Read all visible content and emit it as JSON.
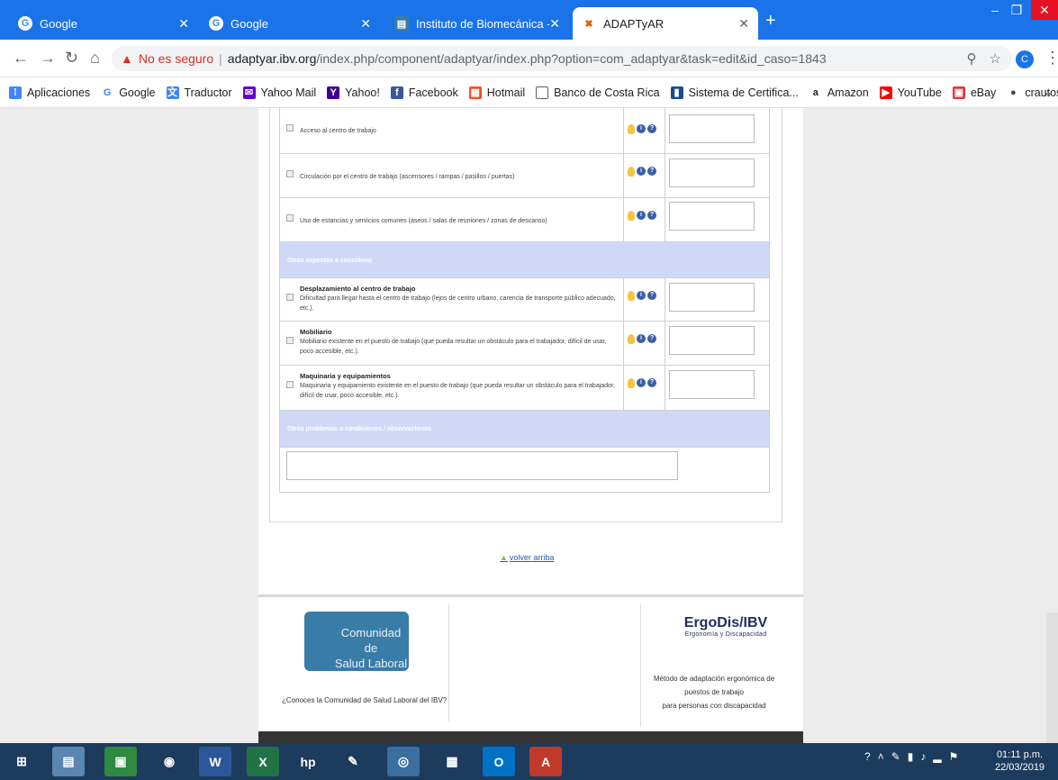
{
  "tabs": [
    {
      "title": "Google",
      "icon": "google-icon"
    },
    {
      "title": "Google",
      "icon": "google-icon"
    },
    {
      "title": "Instituto de Biomecánica - ¿Qué",
      "icon": "ibv-icon"
    },
    {
      "title": "ADAPTyAR",
      "icon": "adaptyar-icon"
    }
  ],
  "address": {
    "security": "No es seguro",
    "host": "adaptyar.ibv.org",
    "path": "/index.php/component/adaptyar/index.php?option=com_adaptyar&task=edit&id_caso=1843"
  },
  "profile_initial": "C",
  "bookmarks": [
    "Aplicaciones",
    "Google",
    "Traductor",
    "Yahoo Mail",
    "Yahoo!",
    "Facebook",
    "Hotmail",
    "Banco de Costa Rica",
    "Sistema de Certifica...",
    "Amazon",
    "YouTube",
    "eBay",
    "crautos.com"
  ],
  "rows": [
    {
      "title": "",
      "text": "Acceso al centro de trabajo"
    },
    {
      "title": "",
      "text": "Circulación por el centro de trabajo (ascensores / rampas / pasillos / puertas)"
    },
    {
      "title": "",
      "text": "Uso de estancias y servicios comunes (aseos / salas de reuniones / zonas de descanso)"
    },
    {
      "title": "Desplazamiento al centro de trabajo",
      "text": "Dificultad para llegar hasta el centro de trabajo (lejos de centro urbano, carencia de transporte público adecuado, etc.)."
    },
    {
      "title": "Mobiliario",
      "text": "Mobiliario existente en el puesto de trabajo (que pueda resultar un obstáculo para el trabajador, difícil de usar, poco accesible, etc.)."
    },
    {
      "title": "Maquinaria y equipamientos",
      "text": "Maquinaria y equipamiento existente en el puesto de trabajo (que pueda resultar un obstáculo para el trabajador, difícil de usar, poco accesible, etc.)."
    }
  ],
  "sections": {
    "otros_aspectos": "Otros aspectos a considerar",
    "otros_problemas": "Otros problemas o condiciones / observaciones"
  },
  "back_to_top": "volver arriba",
  "footer": {
    "com_logo_line1": "Comunidad de",
    "com_logo_line2": "Salud Laboral",
    "com_question": "¿Conoces la Comunidad de Salud Laboral del IBV?",
    "ergo_brand": "ErgoDis/IBV",
    "ergo_sub": "Ergonomía y Discapacidad",
    "ergo_desc_1": "Método de adaptación ergonómica de",
    "ergo_desc_2": "puestos de trabajo",
    "ergo_desc_3": "para personas con discapacidad"
  },
  "clock": {
    "time": "01:11 p.m.",
    "date": "22/03/2019"
  },
  "colors": {
    "chrome_blue": "#1a73e8",
    "section_bg": "#cfd9f7",
    "taskbar": "#1d3b5c"
  }
}
